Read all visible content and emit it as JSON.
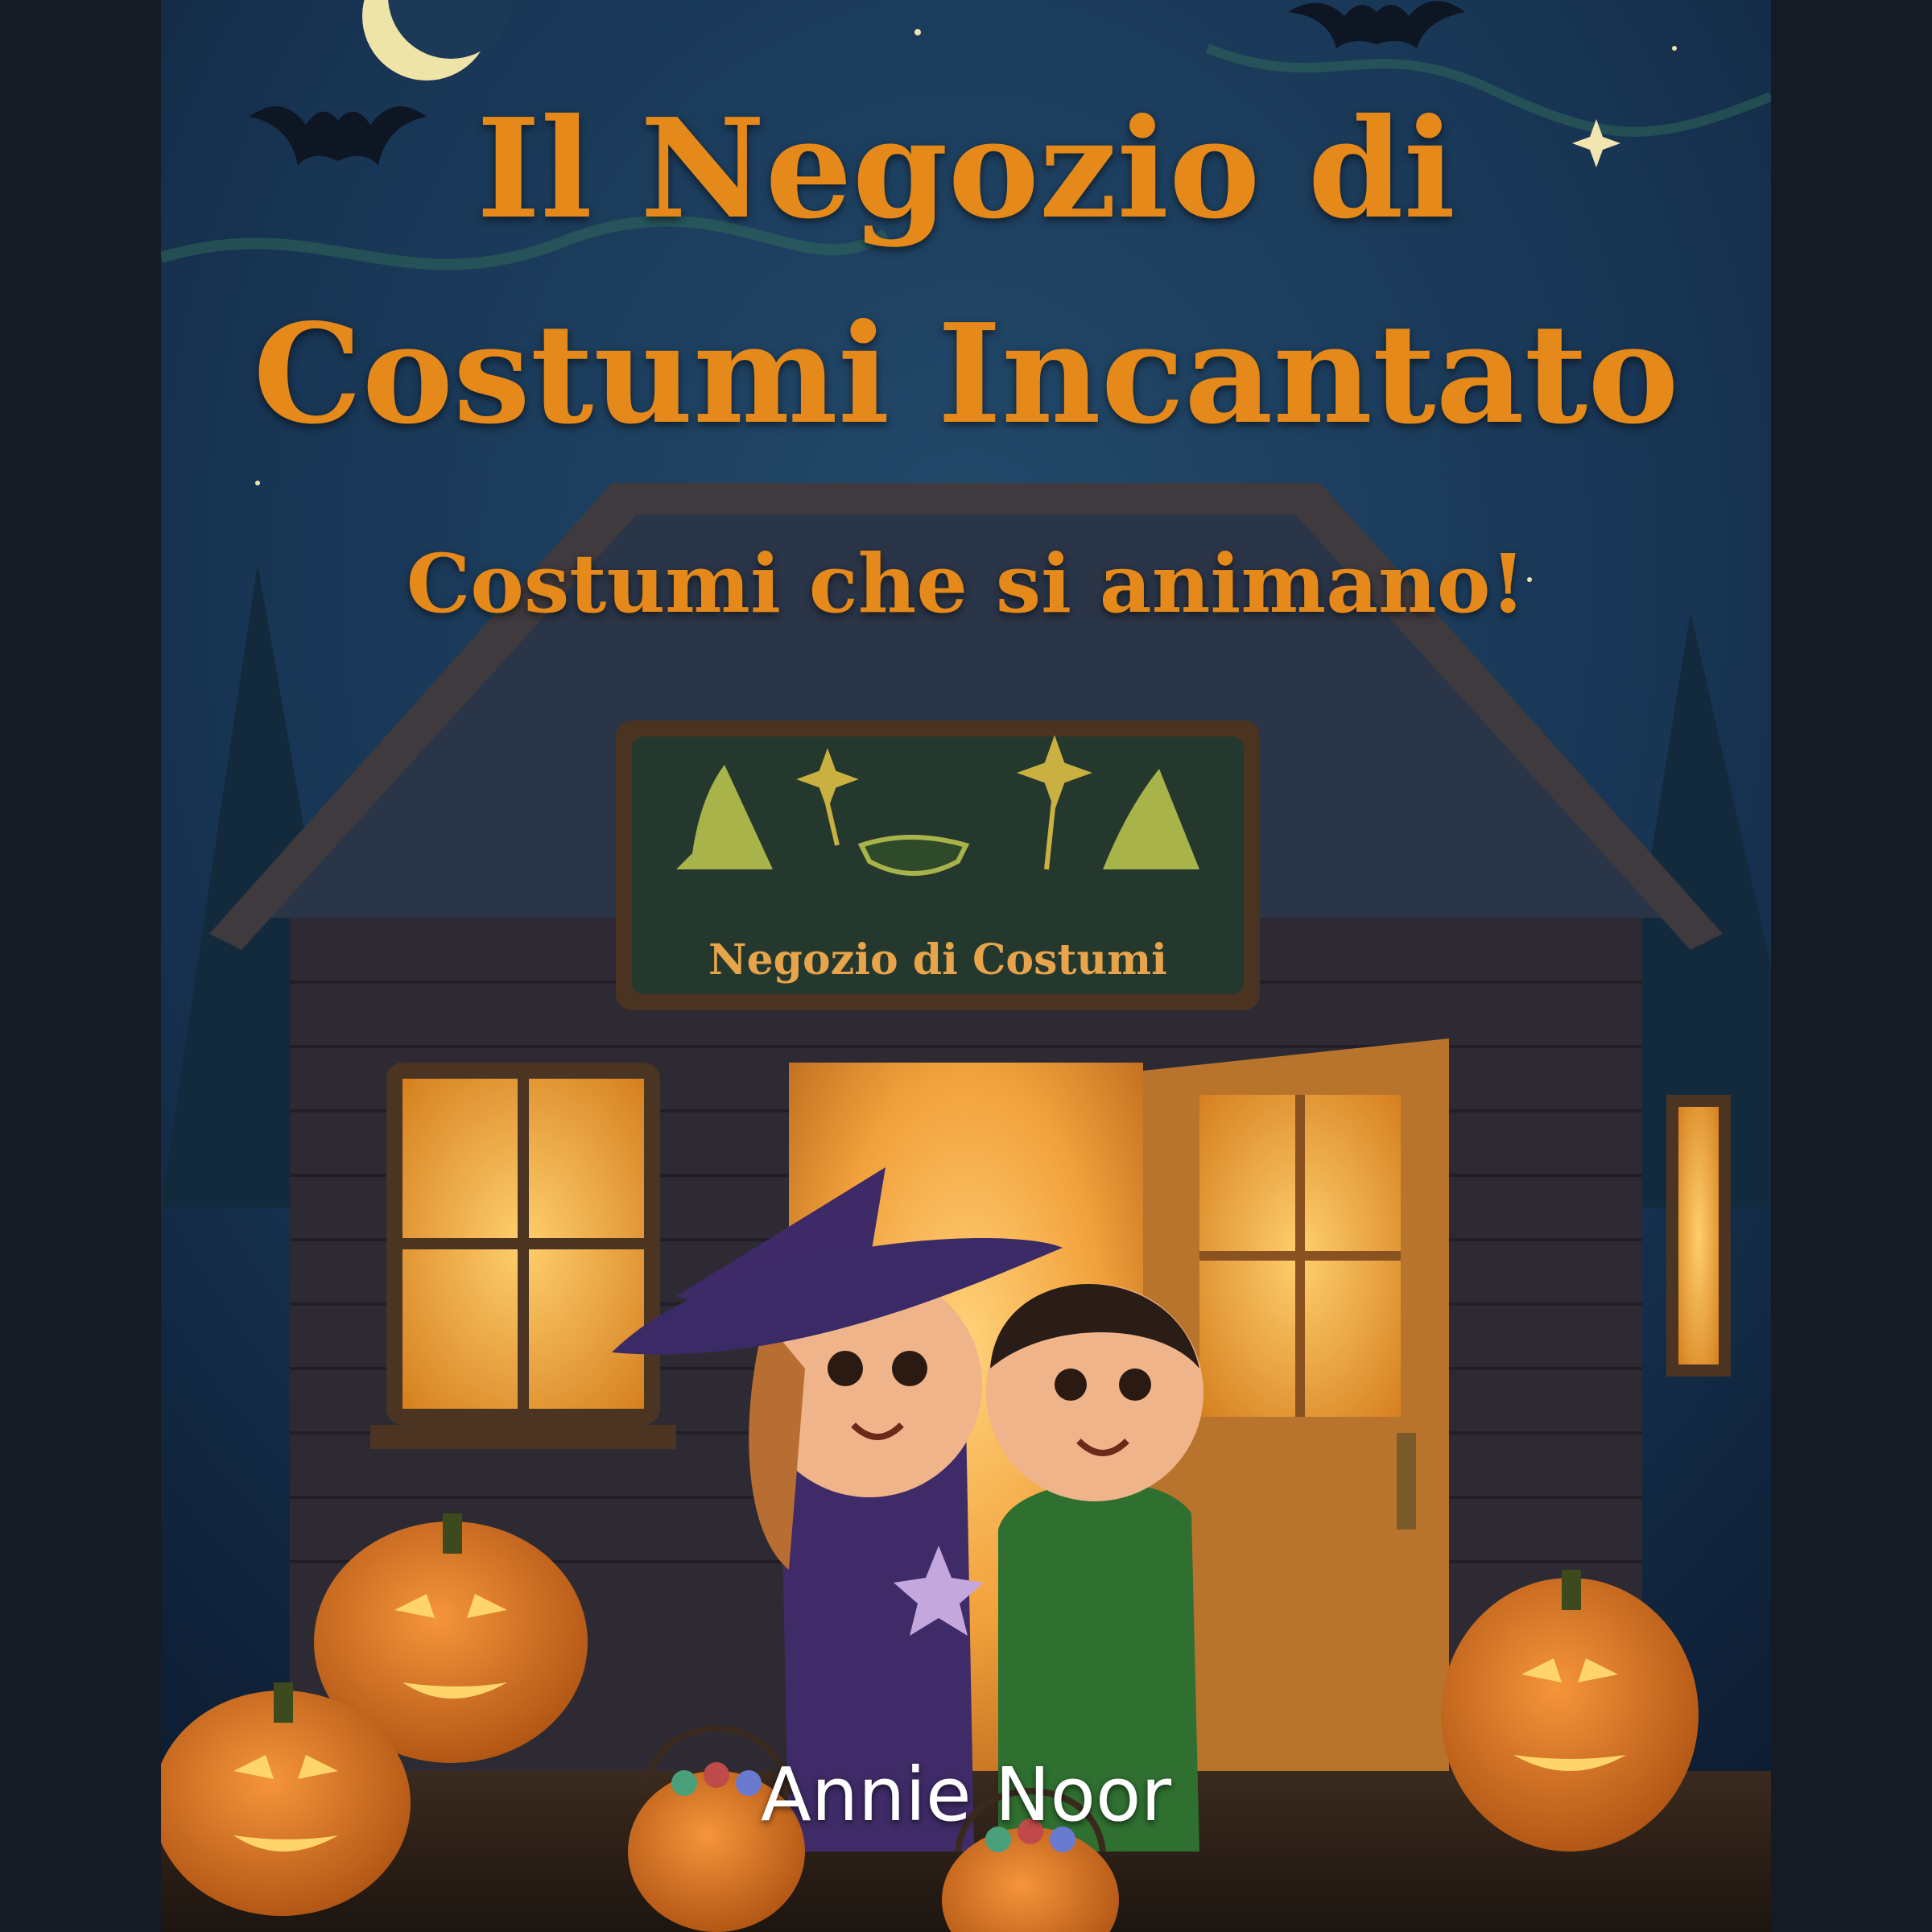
{
  "cover": {
    "title_line1": "Il Negozio di",
    "title_line2": "Costumi Incantato",
    "subtitle": "Costumi che si animano!",
    "shop_sign": "Negozio di Costumi",
    "author": "Annie Noor"
  },
  "colors": {
    "title": "#e4891a",
    "author": "#ffffff",
    "page_background": "#161a25",
    "night_sky": "#1b3a5a",
    "window_glow": "#f4a93c"
  },
  "illustration": {
    "icons": [
      "crescent-moon-icon",
      "bat-icon",
      "star-icon",
      "witch-hat-icon",
      "magic-wand-icon",
      "jack-o-lantern-icon",
      "candy-basket-icon"
    ]
  }
}
